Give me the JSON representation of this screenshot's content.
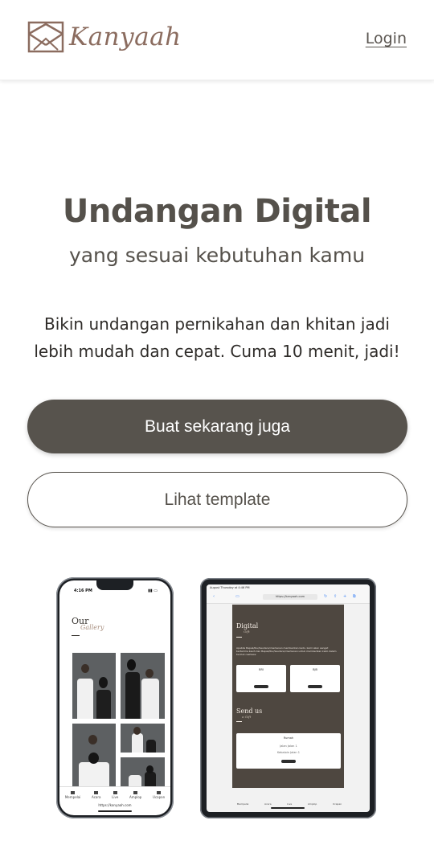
{
  "header": {
    "brand": "Kanyaah",
    "login_label": "Login"
  },
  "hero": {
    "title": "Undangan Digital",
    "subtitle": "yang sesuai kebutuhan kamu",
    "description": "Bikin undangan pernikahan dan khitan jadi lebih mudah dan cepat. Cuma 10 menit, jadi!",
    "primary_button": "Buat sekarang juga",
    "secondary_button": "Lihat template"
  },
  "phone_mockup": {
    "time": "4:16 PM",
    "gallery_title": "Our",
    "gallery_subtitle": "Gallery",
    "nav": [
      "Mempelai",
      "Acara",
      "Live",
      "Amplop",
      "Ucapan"
    ],
    "url": "https://kanyaah.com"
  },
  "tablet_mockup": {
    "date": "August Thursday at 4:46 PM",
    "url": "https://kanyaah.com",
    "section1_title": "Digital",
    "section1_sub": "Gift",
    "section1_text": "Apabila Bapak/Ibu/Saudara/i berkenan memberikan kado, kami akan sangat berterima kasih dan Bapak/Ibu/Saudara/i berkenan untuk memberikan kado dalam bentuk cashless:",
    "bank1": "BRI",
    "bank2": "BJB",
    "copy_label": "Salin",
    "section2_title": "Send us",
    "section2_sub": "a Gift",
    "address_label": "Rumah",
    "address_line1": "Jalan Jalan 1",
    "address_line2": "Kebaloin Jalan 1",
    "nav": [
      "Mempelai",
      "Acara",
      "Live",
      "Amplop",
      "Ucapan"
    ]
  },
  "colors": {
    "primary": "#57534d",
    "brand": "#8b6c5f",
    "text": "#2f2c29"
  }
}
